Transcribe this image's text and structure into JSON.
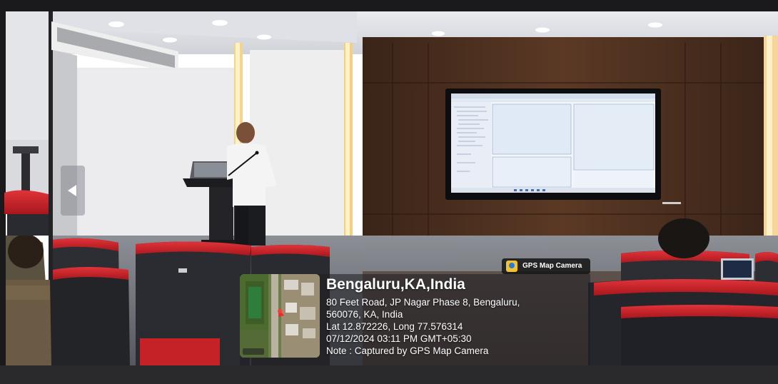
{
  "photo": {
    "description_icon": "photo-icon"
  },
  "gps_badge": {
    "label": "GPS Map Camera",
    "icon": "gps-map-camera-icon"
  },
  "location": {
    "title": "Bengaluru,KA,India",
    "address_line1": "80 Feet Road, JP Nagar Phase 8, Bengaluru,",
    "address_line2": "560076, KA, India",
    "coords": "Lat 12.872226, Long 77.576314",
    "datetime": "07/12/2024 03:11 PM GMT+05:30",
    "note": "Note : Captured by GPS Map Camera"
  },
  "map_thumbnail": {
    "icon": "map-thumbnail-icon"
  },
  "navigation": {
    "prev_icon": "chevron-left-icon"
  }
}
